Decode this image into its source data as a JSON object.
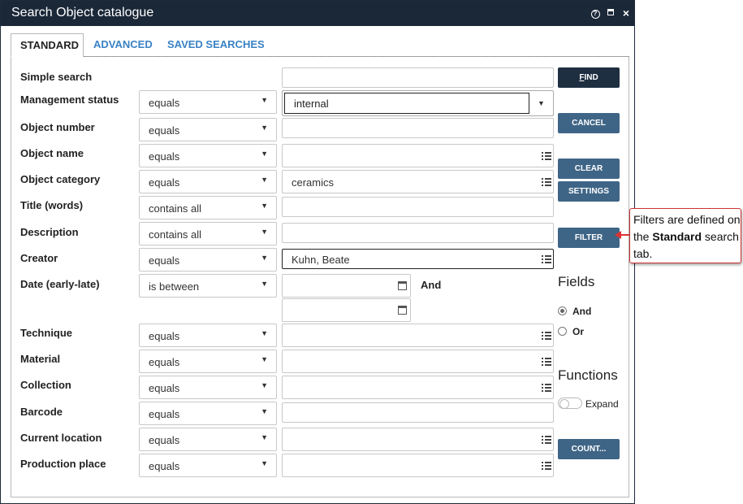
{
  "window": {
    "title": "Search Object catalogue",
    "help_icon": "?",
    "close_icon": "×"
  },
  "tabs": [
    {
      "label": "STANDARD",
      "active": true
    },
    {
      "label": "ADVANCED",
      "active": false
    },
    {
      "label": "SAVED SEARCHES",
      "active": false
    }
  ],
  "simple_search": {
    "label": "Simple search",
    "value": ""
  },
  "management_status": {
    "label": "Management status",
    "operator": "equals",
    "value": "internal"
  },
  "rows": [
    {
      "label": "Object number",
      "operator": "equals",
      "value": "",
      "list_icon": false
    },
    {
      "label": "Object name",
      "operator": "equals",
      "value": "",
      "list_icon": true
    },
    {
      "label": "Object category",
      "operator": "equals",
      "value": "ceramics",
      "list_icon": true
    },
    {
      "label": "Title (words)",
      "operator": "contains all",
      "value": "",
      "list_icon": false
    },
    {
      "label": "Description",
      "operator": "contains all",
      "value": "",
      "list_icon": false
    },
    {
      "label": "Creator",
      "operator": "equals",
      "value": "Kuhn, Beate",
      "list_icon": true
    }
  ],
  "date": {
    "label": "Date (early-late)",
    "operator": "is between",
    "from": "",
    "to": "",
    "and_label": "And"
  },
  "rows2": [
    {
      "label": "Technique",
      "operator": "equals",
      "value": "",
      "list_icon": true
    },
    {
      "label": "Material",
      "operator": "equals",
      "value": "",
      "list_icon": true
    },
    {
      "label": "Collection",
      "operator": "equals",
      "value": "",
      "list_icon": true
    },
    {
      "label": "Barcode",
      "operator": "equals",
      "value": "",
      "list_icon": false
    },
    {
      "label": "Current location",
      "operator": "equals",
      "value": "",
      "list_icon": true
    },
    {
      "label": "Production place",
      "operator": "equals",
      "value": "",
      "list_icon": true
    }
  ],
  "buttons": {
    "find_hotkey": "F",
    "find_rest": "IND",
    "cancel": "CANCEL",
    "clear": "CLEAR",
    "settings": "SETTINGS",
    "filter": "FILTER",
    "count": "COUNT..."
  },
  "fields_section": {
    "title": "Fields",
    "and": "And",
    "or": "Or",
    "selected": "And"
  },
  "functions_section": {
    "title": "Functions",
    "expand": "Expand",
    "expand_on": false
  },
  "callout": {
    "text_before": "Filters are defined on the ",
    "text_bold": "Standard",
    "text_after": " search tab."
  },
  "colors": {
    "titlebar": "#1b2838",
    "button": "#3f6586",
    "find_button": "#1f2f42",
    "tab_link": "#3a82c4",
    "callout_border": "#cc3333"
  }
}
